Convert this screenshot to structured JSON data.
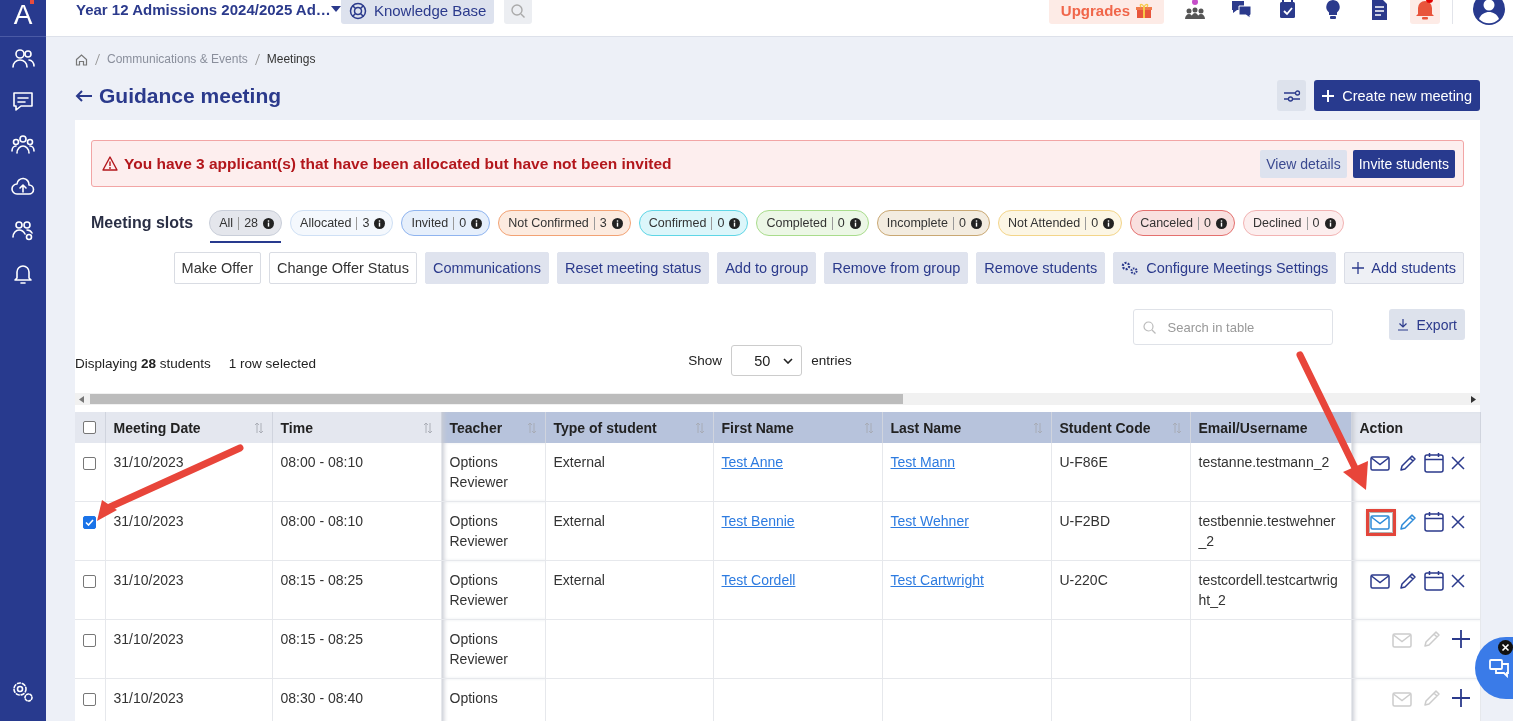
{
  "app": {
    "logo": "A",
    "logo_badge": true
  },
  "topbar": {
    "workspace": "Year 12 Admissions 2024/2025 Ad…",
    "knowledge_base": "Knowledge Base",
    "upgrades": "Upgrades",
    "notifications_unread": true
  },
  "breadcrumb": [
    "Communications & Events",
    "Meetings"
  ],
  "title": "Guidance meeting",
  "create_button": "Create new meeting",
  "alert": {
    "text": "You have 3 applicant(s) that have been allocated but have not been invited",
    "buttons": [
      {
        "label": "View details",
        "kind": "secondary"
      },
      {
        "label": "Invite students",
        "kind": "primary"
      }
    ]
  },
  "slots": {
    "label": "Meeting slots",
    "tabs": [
      {
        "label": "All",
        "count": "28",
        "color": "#c9ced9",
        "selected": true
      },
      {
        "label": "Allocated",
        "count": "3",
        "color": "#cfe0f5",
        "selected": false
      },
      {
        "label": "Invited",
        "count": "0",
        "color": "#8fb4ef",
        "selected": false
      },
      {
        "label": "Not Confirmed",
        "count": "3",
        "color": "#f2a274",
        "selected": false
      },
      {
        "label": "Confirmed",
        "count": "0",
        "color": "#5fd6e6",
        "selected": false
      },
      {
        "label": "Completed",
        "count": "0",
        "color": "#a9dc8c",
        "selected": false
      },
      {
        "label": "Incomplete",
        "count": "0",
        "color": "#c9a873",
        "selected": false
      },
      {
        "label": "Not Attended",
        "count": "0",
        "color": "#f3d58a",
        "selected": false
      },
      {
        "label": "Canceled",
        "count": "0",
        "color": "#e4706e",
        "selected": false
      },
      {
        "label": "Declined",
        "count": "0",
        "color": "#f2b3b3",
        "selected": false
      }
    ]
  },
  "actions": [
    {
      "label": "Make Offer",
      "kind": "outline"
    },
    {
      "label": "Change Offer Status",
      "kind": "outline"
    },
    {
      "label": "Communications",
      "kind": "filled"
    },
    {
      "label": "Reset meeting status",
      "kind": "filled"
    },
    {
      "label": "Add to group",
      "kind": "filled"
    },
    {
      "label": "Remove from group",
      "kind": "filled"
    },
    {
      "label": "Remove students",
      "kind": "filled"
    },
    {
      "label": "Configure Meetings Settings",
      "kind": "gear"
    },
    {
      "label": "Add students",
      "kind": "add"
    }
  ],
  "search": {
    "placeholder": "Search in table"
  },
  "export": "Export",
  "summary": {
    "displaying": "Displaying **28** students",
    "selection": "1 row selected"
  },
  "page_size": {
    "label": "Show",
    "value": "50",
    "suffix": "entries"
  },
  "table": {
    "select_all": false,
    "columns": [
      {
        "label": "Meeting Date",
        "sortable": true,
        "kind": "text",
        "highlighted": false
      },
      {
        "label": "Time",
        "sortable": true,
        "kind": "text",
        "highlighted": false
      },
      {
        "label": "Teacher",
        "sortable": true,
        "kind": "text",
        "highlighted": true
      },
      {
        "label": "Type of student",
        "sortable": true,
        "kind": "text",
        "highlighted": true
      },
      {
        "label": "First Name",
        "sortable": true,
        "kind": "link",
        "highlighted": true
      },
      {
        "label": "Last Name",
        "sortable": true,
        "kind": "link",
        "highlighted": true
      },
      {
        "label": "Student Code",
        "sortable": true,
        "kind": "text",
        "highlighted": true
      },
      {
        "label": "Email/Username",
        "sortable": false,
        "kind": "text",
        "highlighted": true
      },
      {
        "label": "Action",
        "sortable": false,
        "kind": "actions",
        "highlighted": false
      }
    ],
    "rows": [
      {
        "selected": false,
        "cells": [
          "31/10/2023",
          "08:00 - 08:10",
          "Options Reviewer",
          "External",
          "Test Anne",
          "Test Mann",
          "U-F86E",
          "testanne.testmann_2"
        ],
        "actions": {
          "kind": "booked",
          "annotated": false
        }
      },
      {
        "selected": true,
        "cells": [
          "31/10/2023",
          "08:00 - 08:10",
          "Options Reviewer",
          "External",
          "Test Bennie",
          "Test Wehner",
          "U-F2BD",
          "testbennie.testwehner_2"
        ],
        "actions": {
          "kind": "booked",
          "annotated": true
        }
      },
      {
        "selected": false,
        "cells": [
          "31/10/2023",
          "08:15 - 08:25",
          "Options Reviewer",
          "External",
          "Test Cordell",
          "Test Cartwright",
          "U-220C",
          "testcordell.testcartwright_2"
        ],
        "actions": {
          "kind": "booked",
          "annotated": false
        }
      },
      {
        "selected": false,
        "cells": [
          "31/10/2023",
          "08:15 - 08:25",
          "Options Reviewer"
        ],
        "actions": {
          "kind": "open",
          "annotated": false
        }
      },
      {
        "selected": false,
        "cells": [
          "31/10/2023",
          "08:30 - 08:40",
          "Options"
        ],
        "actions": {
          "kind": "open",
          "annotated": false
        }
      }
    ]
  }
}
